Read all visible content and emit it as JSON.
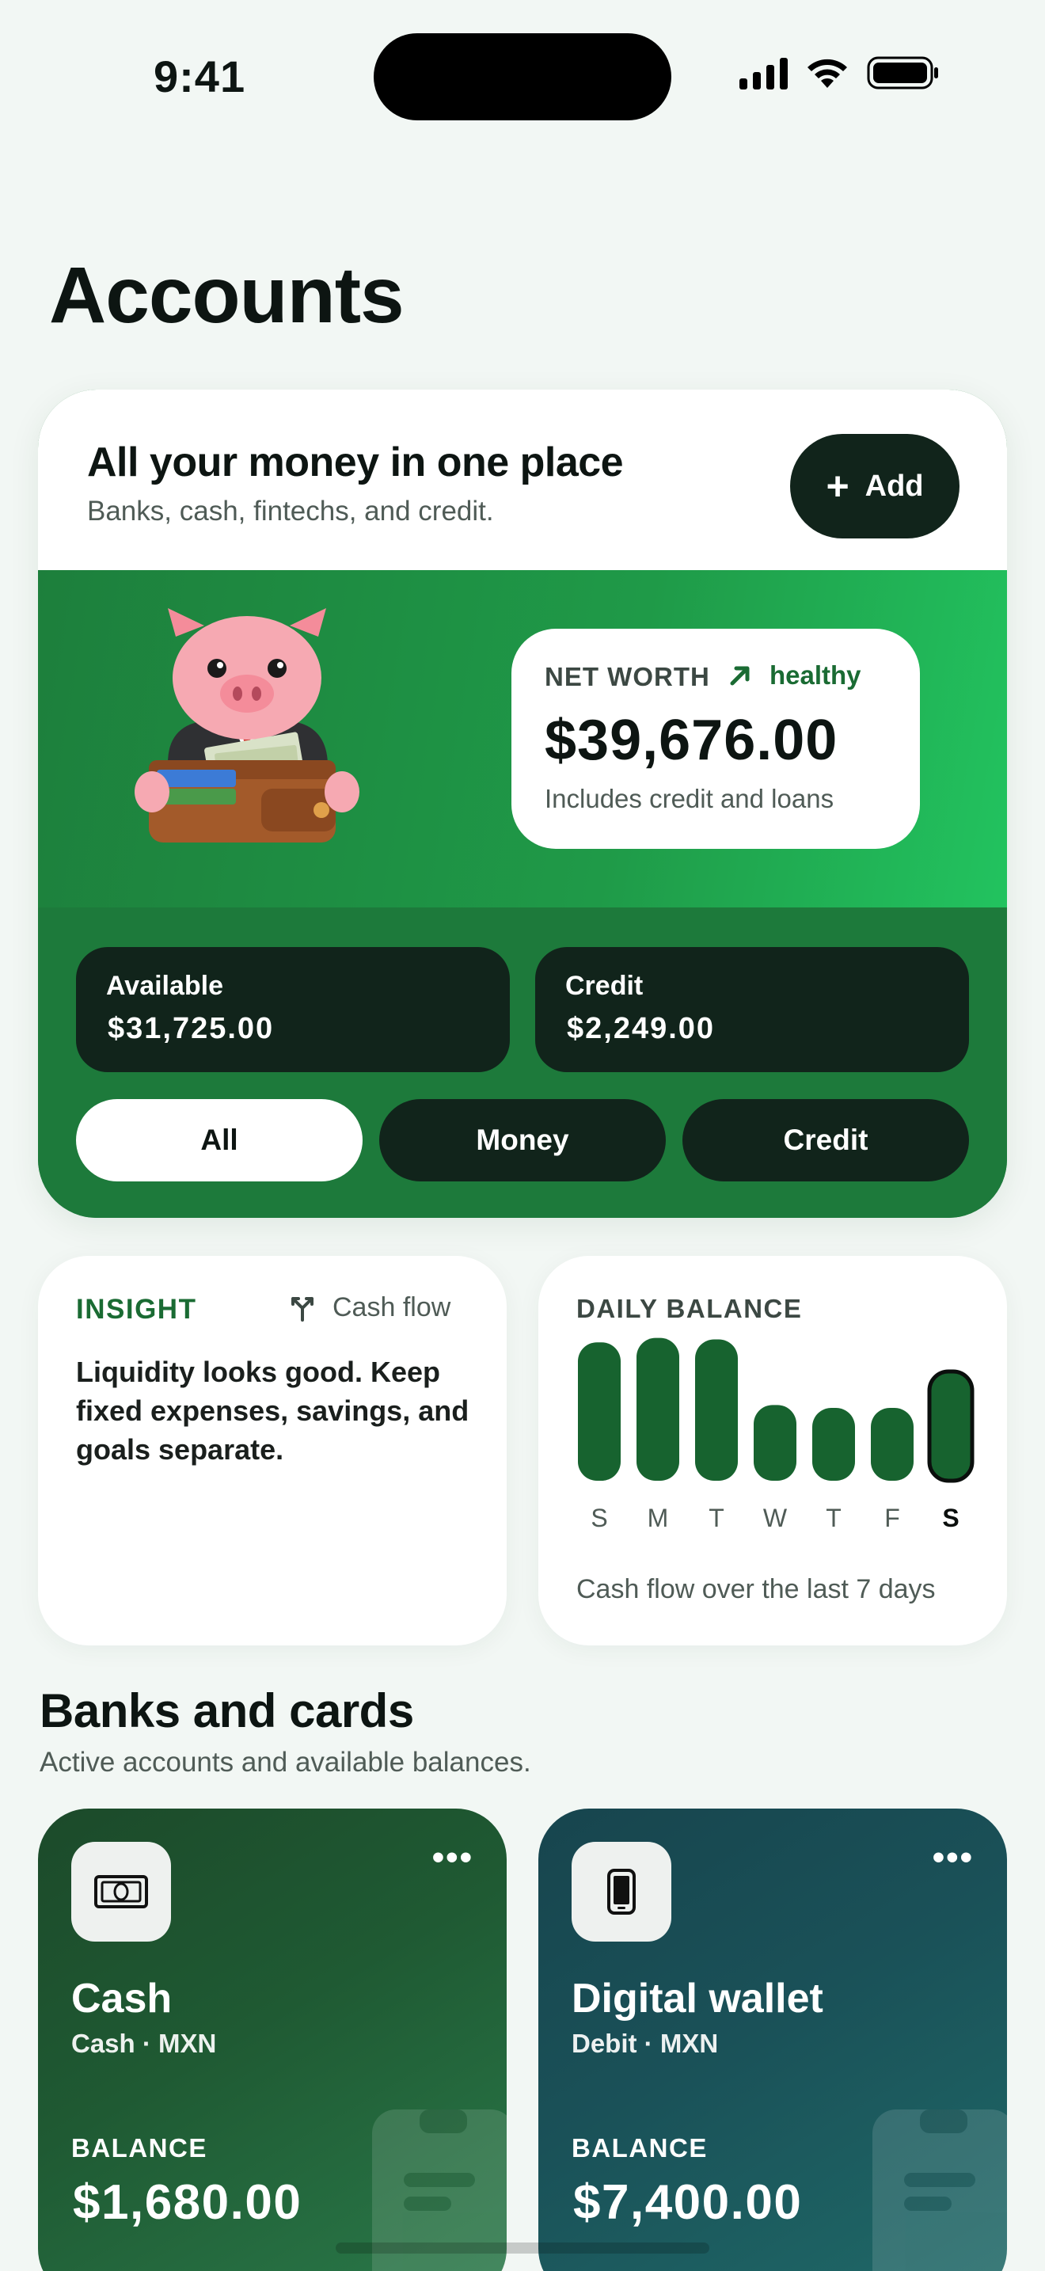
{
  "status_bar": {
    "time": "9:41"
  },
  "page": {
    "title": "Accounts"
  },
  "hero": {
    "title": "All your money in one place",
    "subtitle": "Banks, cash, fintechs, and credit.",
    "add_label": "Add",
    "net_worth": {
      "label": "NET WORTH",
      "trend": "healthy",
      "value": "$39,676.00",
      "note": "Includes credit and loans"
    },
    "stats": [
      {
        "label": "Available",
        "value": "$31,725.00"
      },
      {
        "label": "Credit",
        "value": "$2,249.00"
      }
    ],
    "filters": [
      {
        "label": "All",
        "active": true
      },
      {
        "label": "Money",
        "active": false
      },
      {
        "label": "Credit",
        "active": false
      }
    ]
  },
  "insight": {
    "tag": "INSIGHT",
    "flow_label": "Cash flow",
    "text": "Liquidity looks good. Keep fixed expenses, savings, and goals separate."
  },
  "daily_balance": {
    "tag": "DAILY BALANCE",
    "note": "Cash flow over the last 7 days"
  },
  "chart_data": {
    "type": "bar",
    "categories": [
      "S",
      "M",
      "T",
      "W",
      "T",
      "F",
      "S"
    ],
    "values": [
      95,
      98,
      97,
      52,
      50,
      50,
      75
    ],
    "highlight_index": 6,
    "ylim": [
      0,
      100
    ],
    "color": "#17632f"
  },
  "banks": {
    "title": "Banks and cards",
    "subtitle": "Active accounts and available balances.",
    "accounts": [
      {
        "name": "Cash",
        "type": "Cash · MXN",
        "balance_label": "BALANCE",
        "balance": "$1,680.00",
        "more": "•••",
        "icon": "banknote-icon"
      },
      {
        "name": "Digital wallet",
        "type": "Debit · MXN",
        "balance_label": "BALANCE",
        "balance": "$7,400.00",
        "more": "•••",
        "icon": "phone-icon"
      }
    ]
  }
}
